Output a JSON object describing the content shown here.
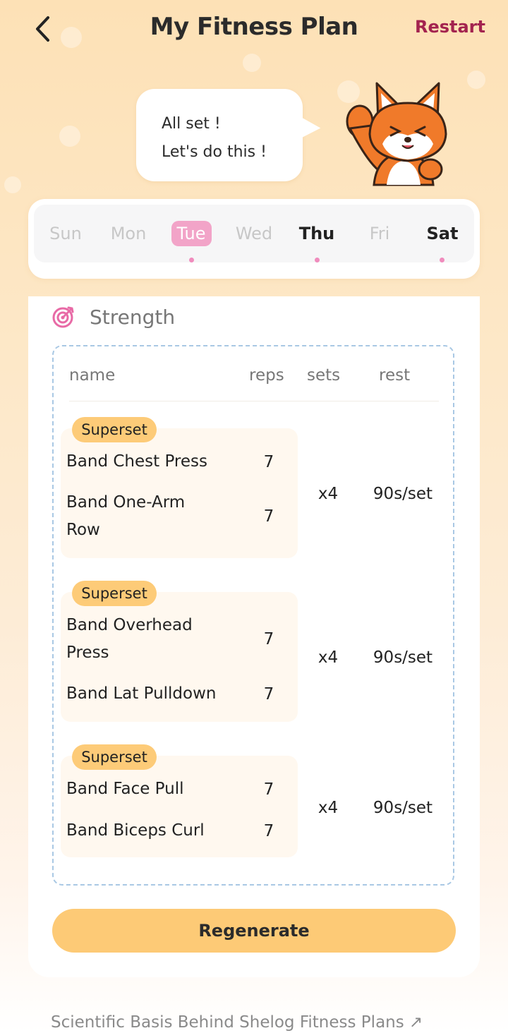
{
  "header": {
    "title": "My Fitness Plan",
    "restart_label": "Restart"
  },
  "bubble": {
    "line1": "All set !",
    "line2": "Let's do this !"
  },
  "days": [
    {
      "label": "Sun",
      "state": "inactive",
      "dot": false
    },
    {
      "label": "Mon",
      "state": "inactive",
      "dot": false
    },
    {
      "label": "Tue",
      "state": "selected",
      "dot": true
    },
    {
      "label": "Wed",
      "state": "inactive",
      "dot": false
    },
    {
      "label": "Thu",
      "state": "active",
      "dot": true
    },
    {
      "label": "Fri",
      "state": "inactive",
      "dot": false
    },
    {
      "label": "Sat",
      "state": "active",
      "dot": true
    }
  ],
  "section": {
    "label": "Strength",
    "icon": "target-icon"
  },
  "table": {
    "headers": {
      "name": "name",
      "reps": "reps",
      "sets": "sets",
      "rest": "rest"
    },
    "groups": [
      {
        "badge": "Superset",
        "sets": "x4",
        "rest": "90s/set",
        "exercises": [
          {
            "line1": "Band Chest Press",
            "line2": "",
            "reps": "7"
          },
          {
            "line1": "Band One-Arm",
            "line2": "Row",
            "reps": "7"
          }
        ]
      },
      {
        "badge": "Superset",
        "sets": "x4",
        "rest": "90s/set",
        "exercises": [
          {
            "line1": "Band Overhead",
            "line2": "Press",
            "reps": "7"
          },
          {
            "line1": "Band Lat Pulldown",
            "line2": "",
            "reps": "7"
          }
        ]
      },
      {
        "badge": "Superset",
        "sets": "x4",
        "rest": "90s/set",
        "exercises": [
          {
            "line1": "Band Face Pull",
            "line2": "",
            "reps": "7"
          },
          {
            "line1": "Band Biceps Curl",
            "line2": "",
            "reps": "7"
          }
        ]
      }
    ]
  },
  "regenerate_label": "Regenerate",
  "footer_link": "Scientific Basis Behind Shelog Fitness Plans ↗",
  "colors": {
    "accent_pink": "#f2a4c8",
    "restart": "#a3234f",
    "button": "#fdca76",
    "badge": "#fdcb78"
  }
}
